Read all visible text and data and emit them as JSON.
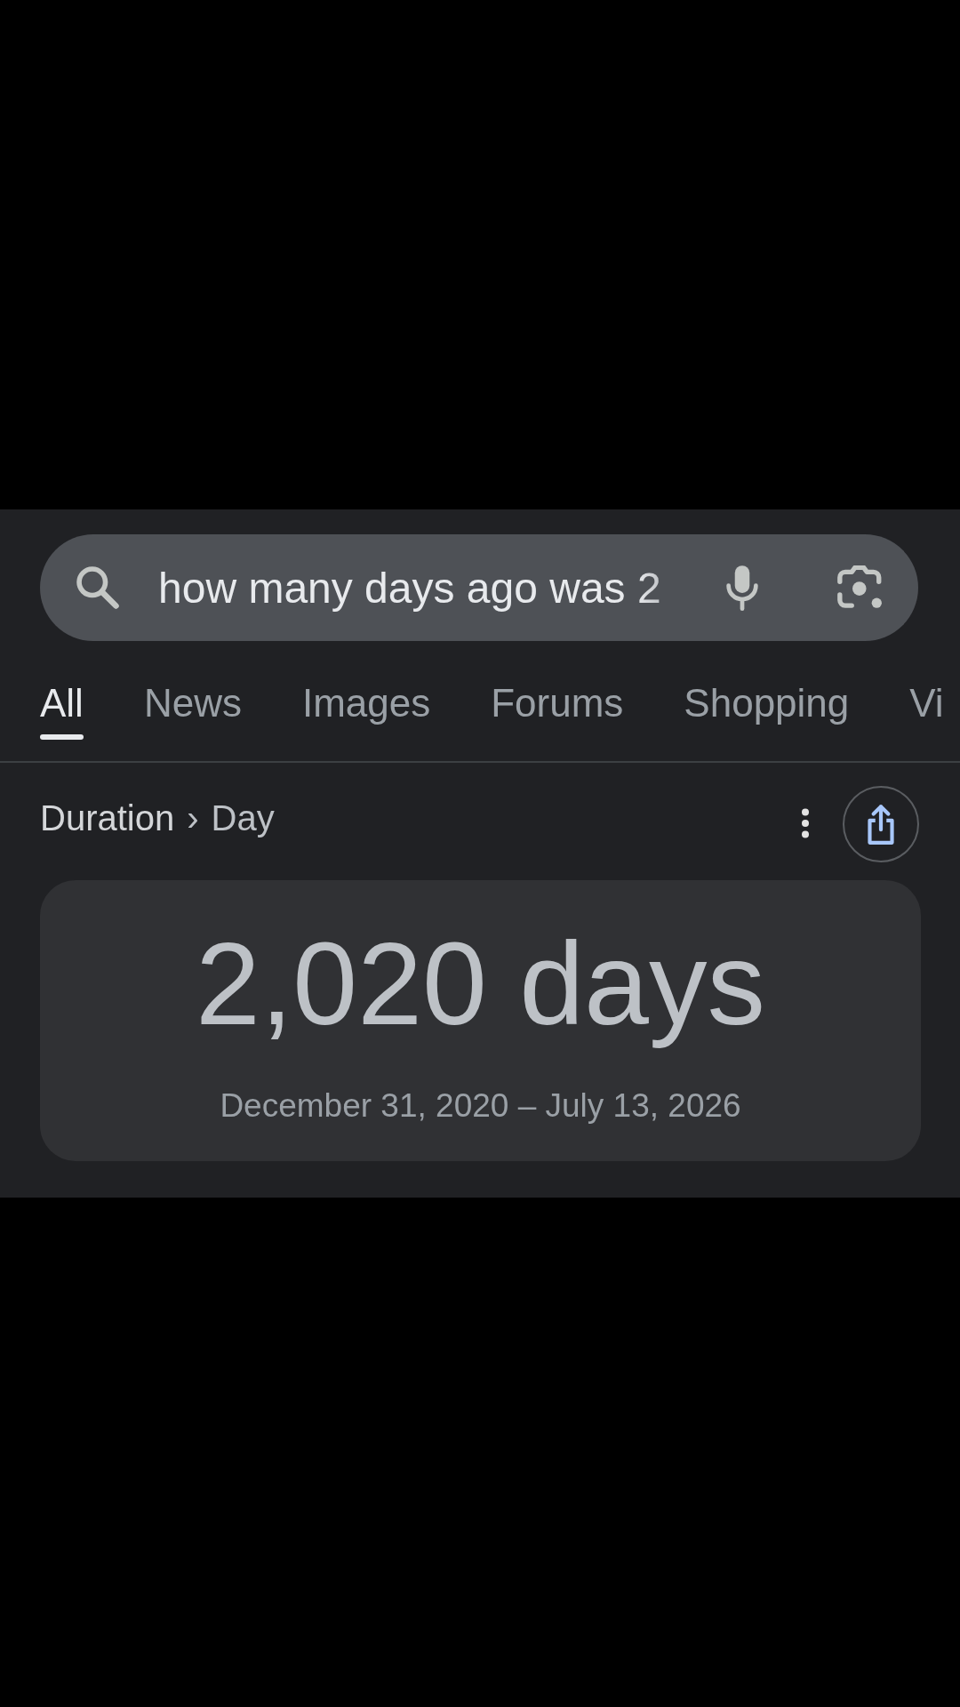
{
  "search": {
    "value": "how many days ago was 2"
  },
  "tabs": [
    {
      "label": "All",
      "selected": true
    },
    {
      "label": "News",
      "selected": false
    },
    {
      "label": "Images",
      "selected": false
    },
    {
      "label": "Forums",
      "selected": false
    },
    {
      "label": "Shopping",
      "selected": false
    },
    {
      "label": "Vi",
      "selected": false
    }
  ],
  "breadcrumb": {
    "items": [
      "Duration",
      "Day"
    ],
    "separator": "›"
  },
  "result": {
    "value": "2,020 days",
    "range": "December 31, 2020 – July 13, 2026"
  }
}
